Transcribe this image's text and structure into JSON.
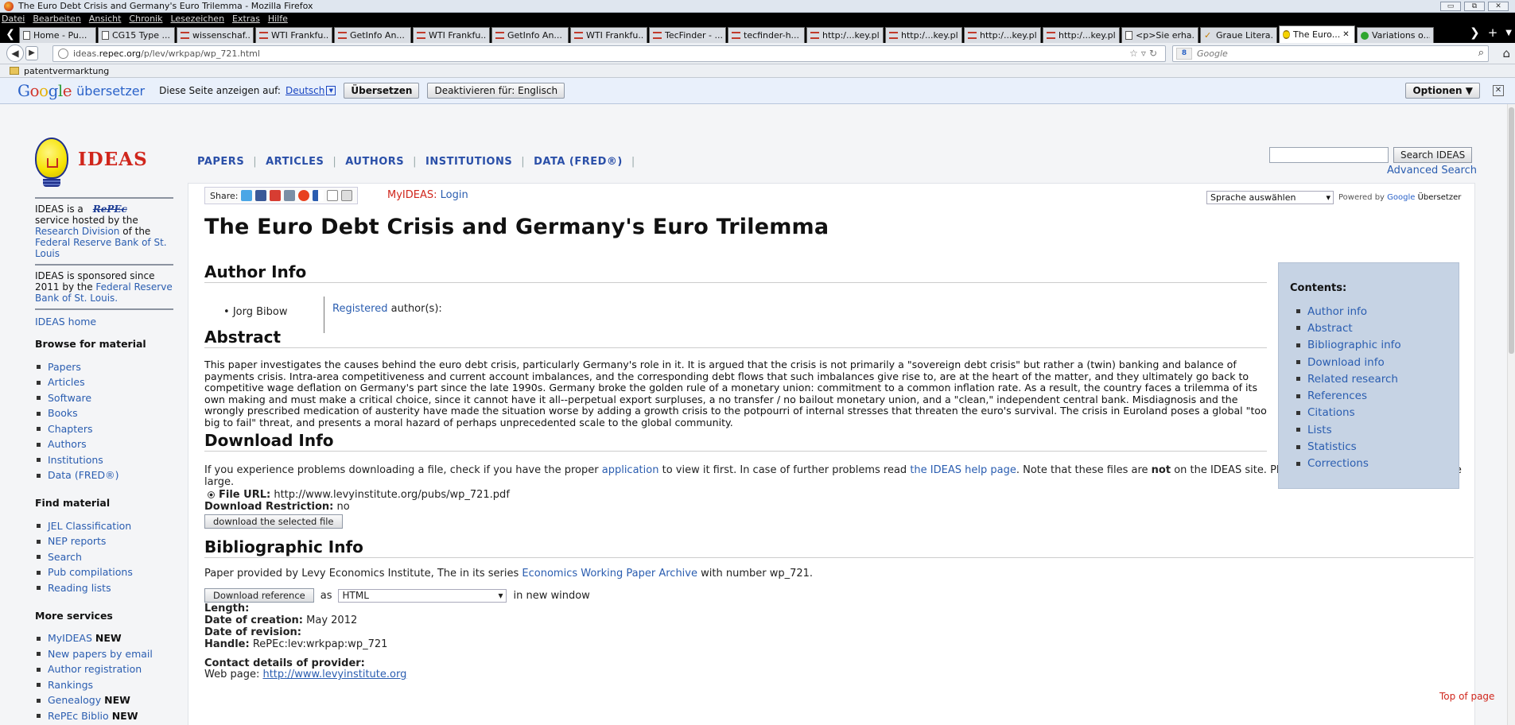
{
  "window": {
    "title": "The Euro Debt Crisis and Germany's Euro Trilemma - Mozilla Firefox",
    "buttons": [
      "▭",
      "⧉",
      "✕"
    ]
  },
  "menubar": [
    "Datei",
    "Bearbeiten",
    "Ansicht",
    "Chronik",
    "Lesezeichen",
    "Extras",
    "Hilfe"
  ],
  "tabs": [
    {
      "label": "Home - Pu...",
      "icon": "scroll-icon"
    },
    {
      "label": "CG15 Type ...",
      "icon": "doc-icon"
    },
    {
      "label": "wissenschaf...",
      "icon": "wti-icon"
    },
    {
      "label": "WTI Frankfu...",
      "icon": "wti-icon"
    },
    {
      "label": "GetInfo An...",
      "icon": "wti-icon"
    },
    {
      "label": "WTI Frankfu...",
      "icon": "wti-icon"
    },
    {
      "label": "GetInfo An...",
      "icon": "wti-icon"
    },
    {
      "label": "WTI Frankfu...",
      "icon": "wti-icon"
    },
    {
      "label": "TecFinder - ...",
      "icon": "wti-icon"
    },
    {
      "label": "tecfinder-h...",
      "icon": "wti-icon"
    },
    {
      "label": "http:/...key.pl",
      "icon": "wti-icon"
    },
    {
      "label": "http:/...key.pl",
      "icon": "wti-icon"
    },
    {
      "label": "http:/...key.pl",
      "icon": "wti-icon"
    },
    {
      "label": "http:/...key.pl",
      "icon": "wti-icon"
    },
    {
      "label": "<p>Sie erha...",
      "icon": "tib-icon"
    },
    {
      "label": "Graue Litera...",
      "icon": "check-icon"
    },
    {
      "label": "The Euro...",
      "icon": "bulb-icon",
      "selected": true
    },
    {
      "label": "Variations o...",
      "icon": "green-icon"
    }
  ],
  "nav": {
    "url_prefix": "ideas.",
    "url_domain": "repec.org",
    "url_path": "/p/lev/wrkpap/wp_721.html",
    "search_engine_label": "Google"
  },
  "bookmarks": [
    "patentvermarktung"
  ],
  "translate_bar": {
    "logo_letters": [
      "G",
      "o",
      "o",
      "g",
      "l",
      "e"
    ],
    "title": "übersetzer",
    "prompt": "Diese Seite anzeigen auf:",
    "language": "Deutsch",
    "translate_button": "Übersetzen",
    "disable_button": "Deaktivieren für: Englisch",
    "options_button": "Optionen ▼",
    "close": "✕"
  },
  "site": {
    "logo_text": "IDEAS",
    "topnav": [
      "PAPERS",
      "ARTICLES",
      "AUTHORS",
      "INSTITUTIONS",
      "DATA (FRED®)"
    ],
    "search_button": "Search IDEAS",
    "advanced_search": "Advanced Search"
  },
  "sidebar": {
    "intro_1": "IDEAS is a",
    "repec": "RePEc",
    "intro_2": "service hosted by the",
    "intro_link": "Research Division",
    "intro_3": "of the",
    "intro_link2": "Federal Reserve Bank of St. Louis",
    "sponsor_1": "IDEAS is sponsored since 2011 by the",
    "sponsor_link": "Federal Reserve Bank of St. Louis.",
    "home": "IDEAS home",
    "browse_heading": "Browse for material",
    "browse_items": [
      "Papers",
      "Articles",
      "Software",
      "Books",
      "Chapters",
      "Authors",
      "Institutions",
      "Data (FRED®)"
    ],
    "find_heading": "Find material",
    "find_items": [
      "JEL Classification",
      "NEP reports",
      "Search",
      "Pub compilations",
      "Reading lists"
    ],
    "more_heading": "More services",
    "more_items": [
      {
        "label": "MyIDEAS",
        "badge": "NEW"
      },
      {
        "label": "New papers by email",
        "badge": ""
      },
      {
        "label": "Author registration",
        "badge": ""
      },
      {
        "label": "Rankings",
        "badge": ""
      },
      {
        "label": "Genealogy",
        "badge": "NEW"
      },
      {
        "label": "RePEc Biblio",
        "badge": "NEW"
      }
    ]
  },
  "article": {
    "share_label": "Share:",
    "myideas_label": "MyIDEAS:",
    "login_label": "Login",
    "translate_select": "Sprache auswählen",
    "powered_by": "Powered by",
    "powered_google": "Google",
    "powered_service": "Übersetzer",
    "title": "The Euro Debt Crisis and Germany's Euro Trilemma",
    "author_heading": "Author Info",
    "author_name": "Jorg Bibow",
    "registered_link": "Registered",
    "registered_rest": "author(s):",
    "abstract_heading": "Abstract",
    "abstract_text": "This paper investigates the causes behind the euro debt crisis, particularly Germany's role in it. It is argued that the crisis is not primarily a \"sovereign debt crisis\" but rather a (twin) banking and balance of payments crisis. Intra-area competitiveness and current account imbalances, and the corresponding debt flows that such imbalances give rise to, are at the heart of the matter, and they ultimately go back to competitive wage deflation on Germany's part since the late 1990s. Germany broke the golden rule of a monetary union: commitment to a common inflation rate. As a result, the country faces a trilemma of its own making and must make a critical choice, since it cannot have it all--perpetual export surpluses, a no transfer / no bailout monetary union, and a \"clean,\" independent central bank. Misdiagnosis and the wrongly prescribed medication of austerity have made the situation worse by adding a growth crisis to the potpourri of internal stresses that threaten the euro's survival. The crisis in Euroland poses a global \"too big to fail\" threat, and presents a moral hazard of perhaps unprecedented scale to the global community.",
    "download_heading": "Download Info",
    "download_1": "If you experience problems downloading a file, check if you have the proper",
    "download_link1": "application",
    "download_2": "to view it first. In case of further problems read",
    "download_link2": "the IDEAS help page",
    "download_3": ". Note that these files are",
    "download_not": "not",
    "download_4": "on the IDEAS site. Please be patient as the files may be large.",
    "file_url_label": "File URL:",
    "file_url": "http://www.levyinstitute.org/pubs/wp_721.pdf",
    "restriction_label": "Download Restriction:",
    "restriction_value": "no",
    "download_button": "download the selected file",
    "biblio_heading": "Bibliographic Info",
    "biblio_1": "Paper provided by Levy Economics Institute, The in its series",
    "biblio_link": "Economics Working Paper Archive",
    "biblio_2": "with number wp_721.",
    "ref_button": "Download reference",
    "ref_as": "as",
    "ref_format": "HTML",
    "ref_new_window": "in new window",
    "length_label": "Length:",
    "creation_label": "Date of creation:",
    "creation_value": "May 2012",
    "revision_label": "Date of revision:",
    "handle_label": "Handle:",
    "handle_value": "RePEc:lev:wrkpap:wp_721",
    "contact_label": "Contact details of provider:",
    "webpage_label": "Web page:",
    "webpage_value": "http://www.levyinstitute.org"
  },
  "contents": {
    "heading": "Contents:",
    "items": [
      "Author info",
      "Abstract",
      "Bibliographic info",
      "Download info",
      "Related research",
      "References",
      "Citations",
      "Lists",
      "Statistics",
      "Corrections"
    ]
  },
  "top_of_page": "Top of page"
}
